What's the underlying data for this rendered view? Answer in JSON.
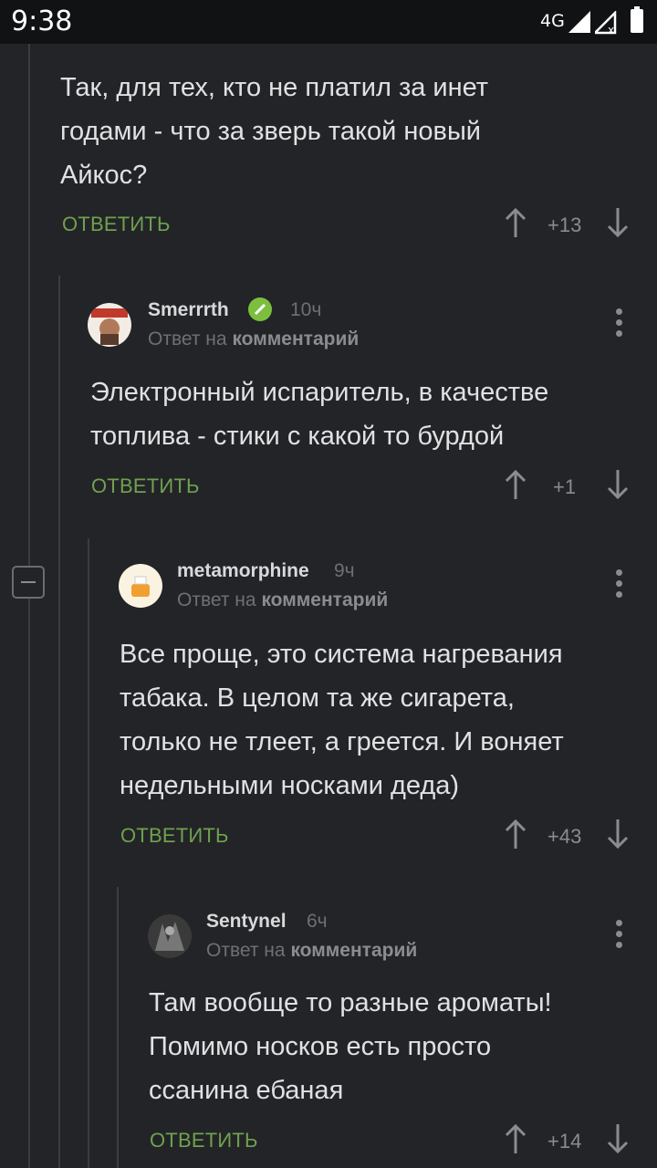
{
  "status_bar": {
    "time": "9:38",
    "network": "4G"
  },
  "comments": [
    {
      "text_lines": [
        "Так, для тех, кто не платил за инет",
        "годами - что за зверь такой новый",
        "Айкос?"
      ],
      "reply_label": "ОТВЕТИТЬ",
      "score": "+13"
    },
    {
      "username": "Smerrrth",
      "time": "10ч",
      "reply_to_prefix": "Ответ на",
      "reply_to_target": "комментарий",
      "text_lines": [
        "Электронный испаритель, в качестве",
        "топлива - стики с какой то бурдой"
      ],
      "reply_label": "ОТВЕТИТЬ",
      "score": "+1"
    },
    {
      "username": "metamorphine",
      "time": "9ч",
      "reply_to_prefix": "Ответ на",
      "reply_to_target": "комментарий",
      "text_lines": [
        "Все проще, это система нагревания",
        "табака. В целом та же сигарета,",
        "только не тлеет, а греется. И воняет",
        "недельными носками деда)"
      ],
      "reply_label": "ОТВЕТИТЬ",
      "score": "+43"
    },
    {
      "username": "Sentynel",
      "time": "6ч",
      "reply_to_prefix": "Ответ на",
      "reply_to_target": "комментарий",
      "text_lines": [
        "Там вообще то разные ароматы!",
        "Помимо носков есть просто",
        "ссанина ебаная"
      ],
      "reply_label": "ОТВЕТИТЬ",
      "score": "+14"
    }
  ],
  "colors": {
    "background": "#232427",
    "reply_link": "#6fa14f",
    "verified_badge": "#7cbf3f"
  }
}
